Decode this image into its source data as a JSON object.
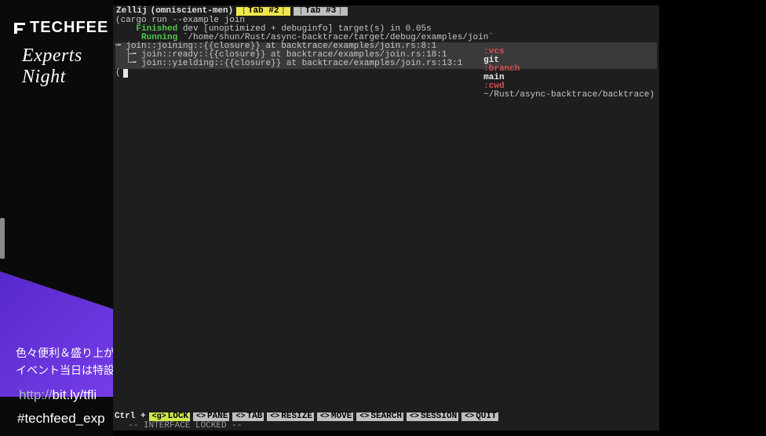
{
  "overlay": {
    "brand": "TECHFEE",
    "script": "Experts Night",
    "jp_line1": "色々便利＆盛り上が",
    "jp_line2": "イベント当日は特設",
    "url_dim": "http://",
    "url_main": "bit.ly/tfli",
    "hashtag": "#techfeed_exp"
  },
  "zellij": {
    "session_label": "Zellij",
    "session_name": "(omniscient-men)",
    "tabs": [
      {
        "label": "Tab #2",
        "active": true
      },
      {
        "label": "Tab #3",
        "active": false
      }
    ]
  },
  "terminal": {
    "cmd": "(cargo run --example join",
    "finished_label": "Finished",
    "finished_rest": " dev [unoptimized + debuginfo] target(s) in 0.05s",
    "running_label": "Running",
    "running_rest": " `/home/shun/Rust/async-backtrace/target/debug/examples/join`",
    "trace": [
      "╼ join::joining::{{closure}} at backtrace/examples/join.rs:8:1",
      "  ├╼ join::ready::{{closure}} at backtrace/examples/join.rs:18:1",
      "  └╼ join::yielding::{{closure}} at backtrace/examples/join.rs:13:1"
    ],
    "prompt_open": "(",
    "right_prompt": {
      "vcs": ":vcs",
      "git": "git",
      "branch_lbl": ":branch",
      "branch": "main",
      "cwd_lbl": ":cwd",
      "cwd": "~/Rust/async-backtrace/backtrace)"
    }
  },
  "bottom": {
    "ctrl": "Ctrl +",
    "modes": [
      {
        "key": "LOCK",
        "lock": true
      },
      {
        "key": "PANE",
        "lock": false
      },
      {
        "key": "TAB",
        "lock": false
      },
      {
        "key": "RESIZE",
        "lock": false
      },
      {
        "key": "MOVE",
        "lock": false
      },
      {
        "key": "SEARCH",
        "lock": false
      },
      {
        "key": "SESSION",
        "lock": false
      },
      {
        "key": "QUIT",
        "lock": false
      }
    ],
    "locked": "  -- INTERFACE LOCKED --"
  }
}
